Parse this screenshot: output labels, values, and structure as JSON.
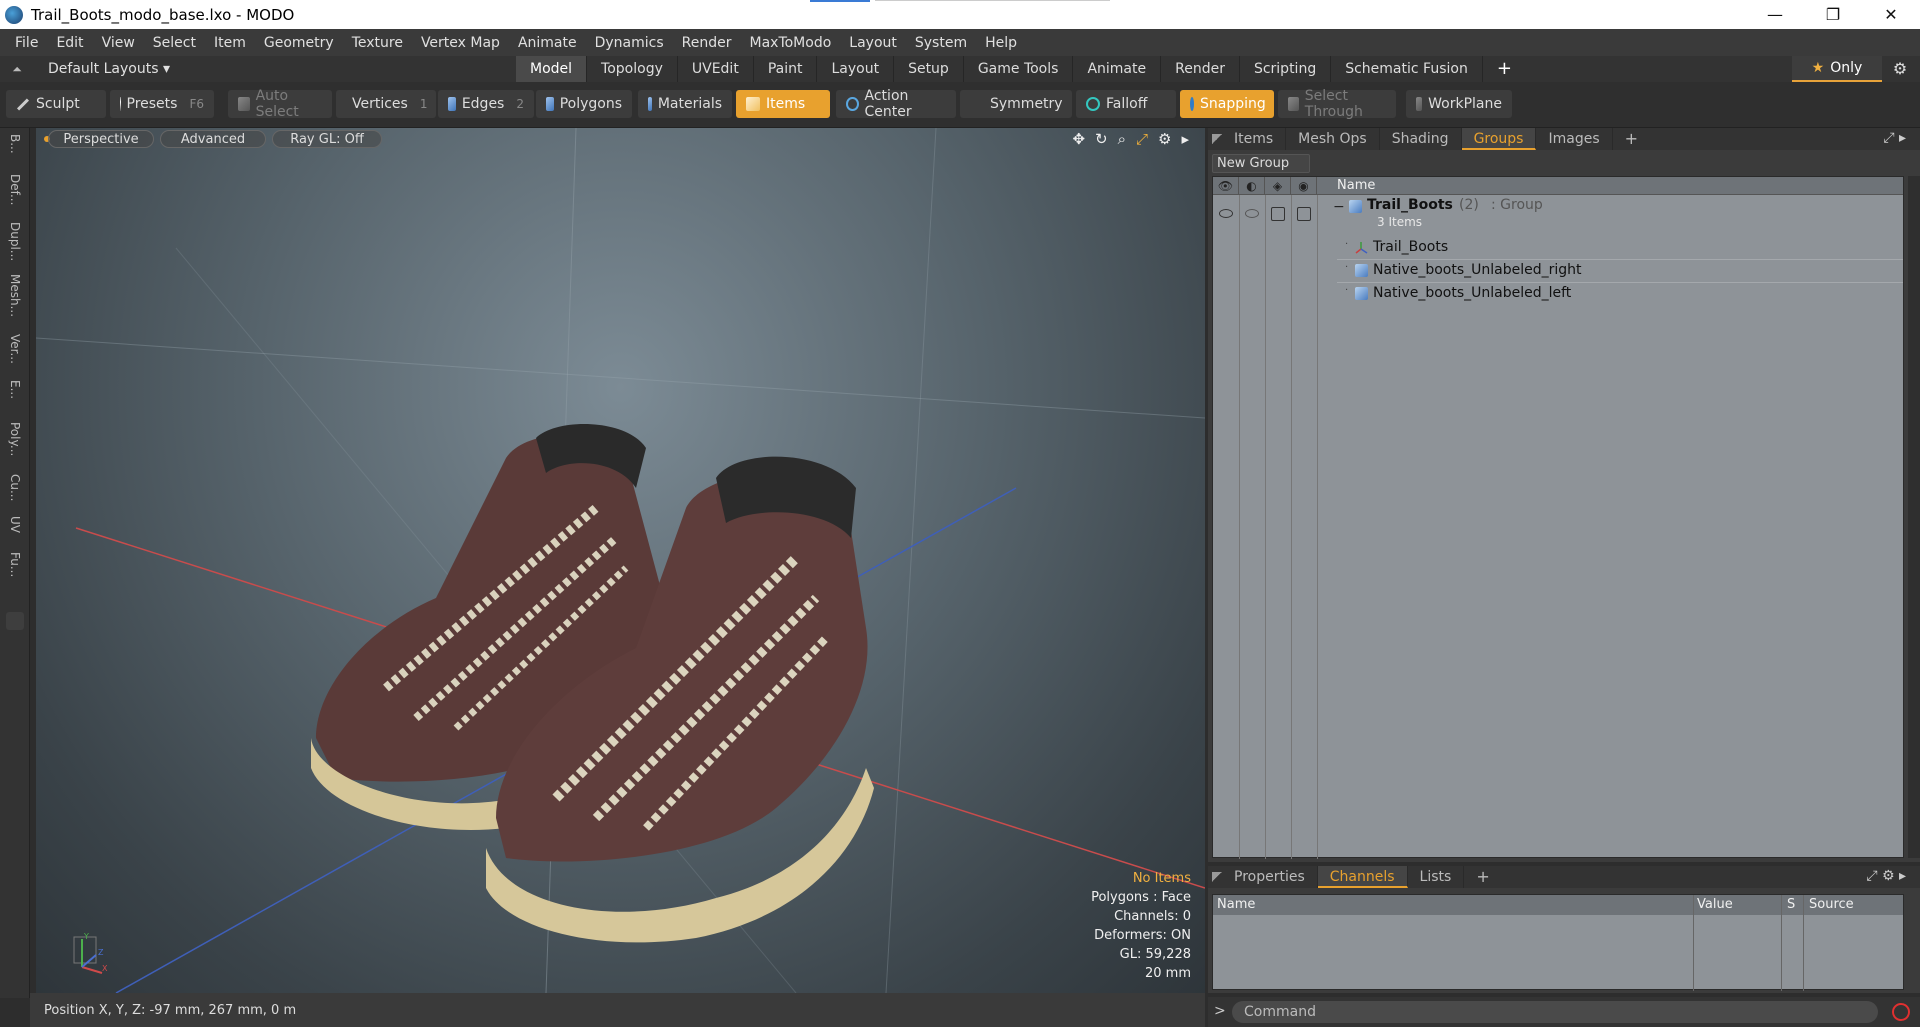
{
  "window": {
    "title": "Trail_Boots_modo_base.lxo - MODO",
    "minimize": "—",
    "restore": "❐",
    "close": "✕"
  },
  "menu": [
    "File",
    "Edit",
    "View",
    "Select",
    "Item",
    "Geometry",
    "Texture",
    "Vertex Map",
    "Animate",
    "Dynamics",
    "Render",
    "MaxToModo",
    "Layout",
    "System",
    "Help"
  ],
  "layoutbar": {
    "layouts_label": "Default Layouts ▾",
    "tabs": [
      "Model",
      "Topology",
      "UVEdit",
      "Paint",
      "Layout",
      "Setup",
      "Game Tools",
      "Animate",
      "Render",
      "Scripting",
      "Schematic Fusion"
    ],
    "active_tab": "Model",
    "plus": "+",
    "only_label": "Only",
    "star": "★",
    "gear": "⚙"
  },
  "toolbar": {
    "sculpt": "Sculpt",
    "presets": "Presets",
    "presets_key": "F6",
    "auto_select": "Auto Select",
    "vertices": "Vertices",
    "vertices_key": "1",
    "edges": "Edges",
    "edges_key": "2",
    "polygons": "Polygons",
    "materials": "Materials",
    "items": "Items",
    "action_center": "Action Center",
    "symmetry": "Symmetry",
    "falloff": "Falloff",
    "snapping": "Snapping",
    "select_through": "Select Through",
    "workplane": "WorkPlane"
  },
  "leftbar": {
    "tabs": [
      "B...",
      "Def...",
      "Dupl...",
      "Mesh...",
      "Ver...",
      "E...",
      "Poly...",
      "Cu...",
      "UV",
      "Fu..."
    ]
  },
  "viewport": {
    "view": "Perspective",
    "advanced": "Advanced",
    "raygl": "Ray GL: Off",
    "info": {
      "selection": "No Items",
      "polygons": "Polygons : Face",
      "channels": "Channels: 0",
      "deformers": "Deformers: ON",
      "gl": "GL: 59,228",
      "scale": "20 mm"
    },
    "axis_labels": {
      "x": "X",
      "y": "Y",
      "z": "Z"
    }
  },
  "status": {
    "position": "Position X, Y, Z:  -97 mm, 267 mm, 0 m"
  },
  "right_panel": {
    "tabs": [
      "Items",
      "Mesh Ops",
      "Shading",
      "Groups",
      "Images"
    ],
    "active_tab": "Groups",
    "plus": "+",
    "new_group": "New Group",
    "name_header": "Name",
    "group": {
      "name": "Trail_Boots",
      "count": "(2)",
      "type": ": Group",
      "items_label": "3 Items",
      "children": [
        "Trail_Boots",
        "Native_boots_Unlabeled_right",
        "Native_boots_Unlabeled_left"
      ]
    }
  },
  "bottom_panel": {
    "tabs": [
      "Properties",
      "Channels",
      "Lists"
    ],
    "active_tab": "Channels",
    "plus": "+",
    "columns": [
      "Name",
      "Value",
      "S",
      "Source"
    ]
  },
  "command": {
    "prompt": ">",
    "placeholder": "Command"
  }
}
